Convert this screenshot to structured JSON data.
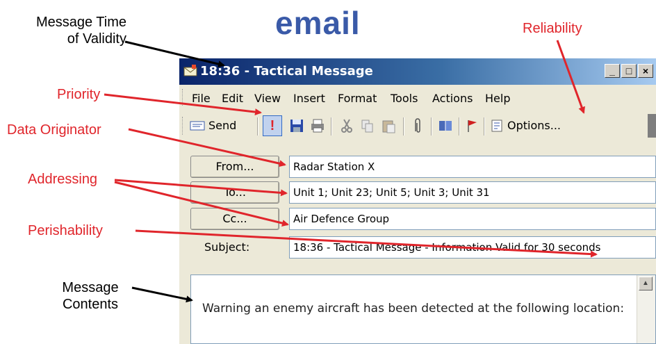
{
  "annotations": {
    "title": "email",
    "message_time_line1": "Message Time",
    "message_time_line2": "of Validity",
    "priority": "Priority",
    "data_originator": "Data Originator",
    "addressing": "Addressing",
    "perishability": "Perishability",
    "message_contents_line1": "Message",
    "message_contents_line2": "Contents",
    "reliability": "Reliability"
  },
  "window": {
    "title": "18:36 - Tactical Message",
    "minimize": "_",
    "maximize": "□",
    "close": "×"
  },
  "menu": [
    "File",
    "Edit",
    "View",
    "Insert",
    "Format",
    "Tools",
    "Actions",
    "Help"
  ],
  "toolbar": {
    "send_label": "Send",
    "options_label": "Options...",
    "priority_glyph": "!"
  },
  "form": {
    "from_label": "From...",
    "from_value": "Radar Station X",
    "to_label": "To...",
    "to_value": "Unit 1; Unit 23; Unit 5; Unit 3; Unit 31",
    "cc_label": "Cc...",
    "cc_value": "Air Defence Group",
    "subject_label": "Subject:",
    "subject_value": "18:36 - Tactical Message - Information Valid for 30 seconds"
  },
  "body": {
    "text": "Warning an enemy aircraft has been detected at the following location:"
  },
  "colors": {
    "annotation_red": "#e0252b",
    "title_blue": "#3a5aa8",
    "titlebar_dark": "#0a246a",
    "titlebar_light": "#a6caf0"
  }
}
